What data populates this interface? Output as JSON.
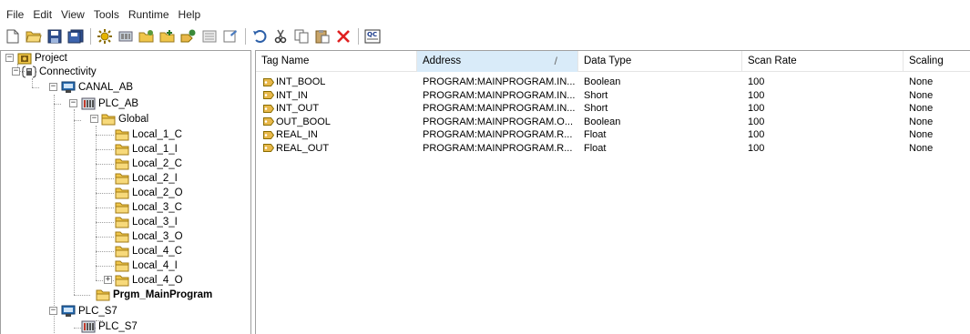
{
  "menu": {
    "items": [
      "File",
      "Edit",
      "View",
      "Tools",
      "Runtime",
      "Help"
    ]
  },
  "toolbar": {
    "buttons": [
      {
        "icon": "new-document-icon"
      },
      {
        "icon": "open-folder-icon"
      },
      {
        "icon": "save-icon"
      },
      {
        "icon": "save-all-icon"
      },
      {
        "icon": "connectivity-icon"
      },
      {
        "icon": "device-icon"
      },
      {
        "icon": "add-group-icon"
      },
      {
        "icon": "add-folder-icon"
      },
      {
        "icon": "add-tag-icon"
      },
      {
        "icon": "properties-icon"
      },
      {
        "icon": "settings-icon"
      },
      {
        "icon": "undo-icon"
      },
      {
        "icon": "cut-icon"
      },
      {
        "icon": "copy-icon"
      },
      {
        "icon": "paste-icon"
      },
      {
        "icon": "delete-icon"
      },
      {
        "icon": "quick-client-icon"
      }
    ]
  },
  "tree": {
    "project": "Project",
    "connectivity": "Connectivity",
    "channel_ab": "CANAL_AB",
    "device_plc_ab": "PLC_AB",
    "global": "Global",
    "groups": [
      "Local_1_C",
      "Local_1_I",
      "Local_2_C",
      "Local_2_I",
      "Local_2_O",
      "Local_3_C",
      "Local_3_I",
      "Local_3_O",
      "Local_4_C",
      "Local_4_I",
      "Local_4_O"
    ],
    "selected": "Prgm_MainProgram",
    "channel_s7": "PLC_S7",
    "device_s7": "PLC_S7"
  },
  "table": {
    "columns": [
      "Tag Name",
      "Address",
      "Data Type",
      "Scan Rate",
      "Scaling"
    ],
    "rows": [
      {
        "name": "INT_BOOL",
        "address": "PROGRAM:MAINPROGRAM.IN...",
        "type": "Boolean",
        "rate": "100",
        "scaling": "None"
      },
      {
        "name": "INT_IN",
        "address": "PROGRAM:MAINPROGRAM.IN...",
        "type": "Short",
        "rate": "100",
        "scaling": "None"
      },
      {
        "name": "INT_OUT",
        "address": "PROGRAM:MAINPROGRAM.IN...",
        "type": "Short",
        "rate": "100",
        "scaling": "None"
      },
      {
        "name": "OUT_BOOL",
        "address": "PROGRAM:MAINPROGRAM.O...",
        "type": "Boolean",
        "rate": "100",
        "scaling": "None"
      },
      {
        "name": "REAL_IN",
        "address": "PROGRAM:MAINPROGRAM.R...",
        "type": "Float",
        "rate": "100",
        "scaling": "None"
      },
      {
        "name": "REAL_OUT",
        "address": "PROGRAM:MAINPROGRAM.R...",
        "type": "Float",
        "rate": "100",
        "scaling": "None"
      }
    ]
  },
  "colors": {
    "folder": "#f0c64a",
    "header_active": "#d9ebf9",
    "tag_icon": "#e8b84a"
  }
}
